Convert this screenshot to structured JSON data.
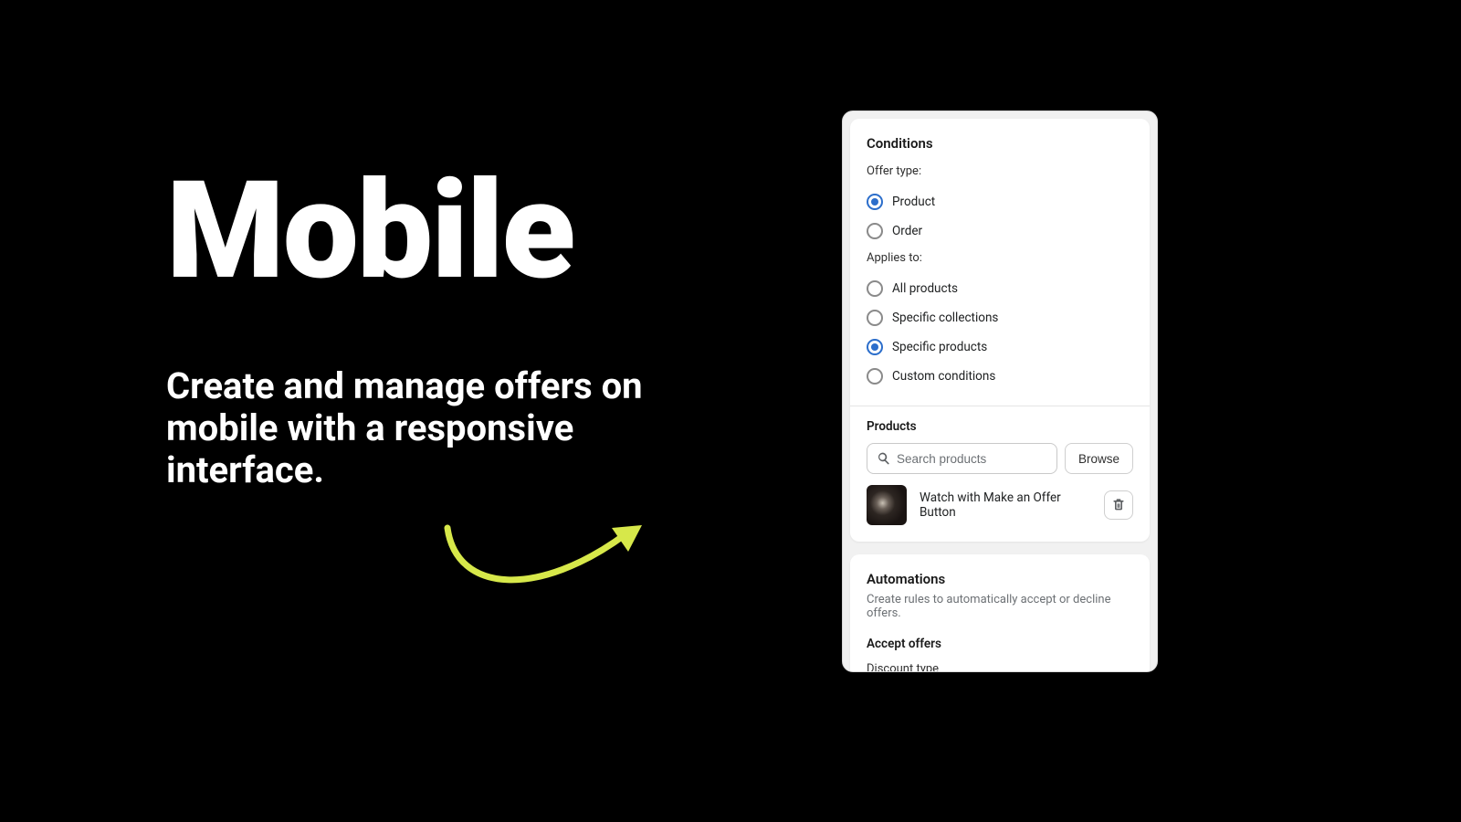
{
  "hero": {
    "title": "Mobile",
    "subtitle": "Create and manage offers on mobile with a responsive interface."
  },
  "conditions": {
    "title": "Conditions",
    "offer_type_label": "Offer type:",
    "offer_types": [
      {
        "label": "Product",
        "selected": true
      },
      {
        "label": "Order",
        "selected": false
      }
    ],
    "applies_to_label": "Applies to:",
    "applies_to": [
      {
        "label": "All products",
        "selected": false
      },
      {
        "label": "Specific collections",
        "selected": false
      },
      {
        "label": "Specific products",
        "selected": true
      },
      {
        "label": "Custom conditions",
        "selected": false
      }
    ]
  },
  "products": {
    "heading": "Products",
    "search_placeholder": "Search products",
    "browse_label": "Browse",
    "items": [
      {
        "name": "Watch with Make an Offer Button"
      }
    ]
  },
  "automations": {
    "title": "Automations",
    "description": "Create rules to automatically accept or decline offers.",
    "accept_heading": "Accept offers",
    "discount_type_label": "Discount type"
  },
  "colors": {
    "accent": "#2c6ecb",
    "arrow": "#d7e84a"
  }
}
